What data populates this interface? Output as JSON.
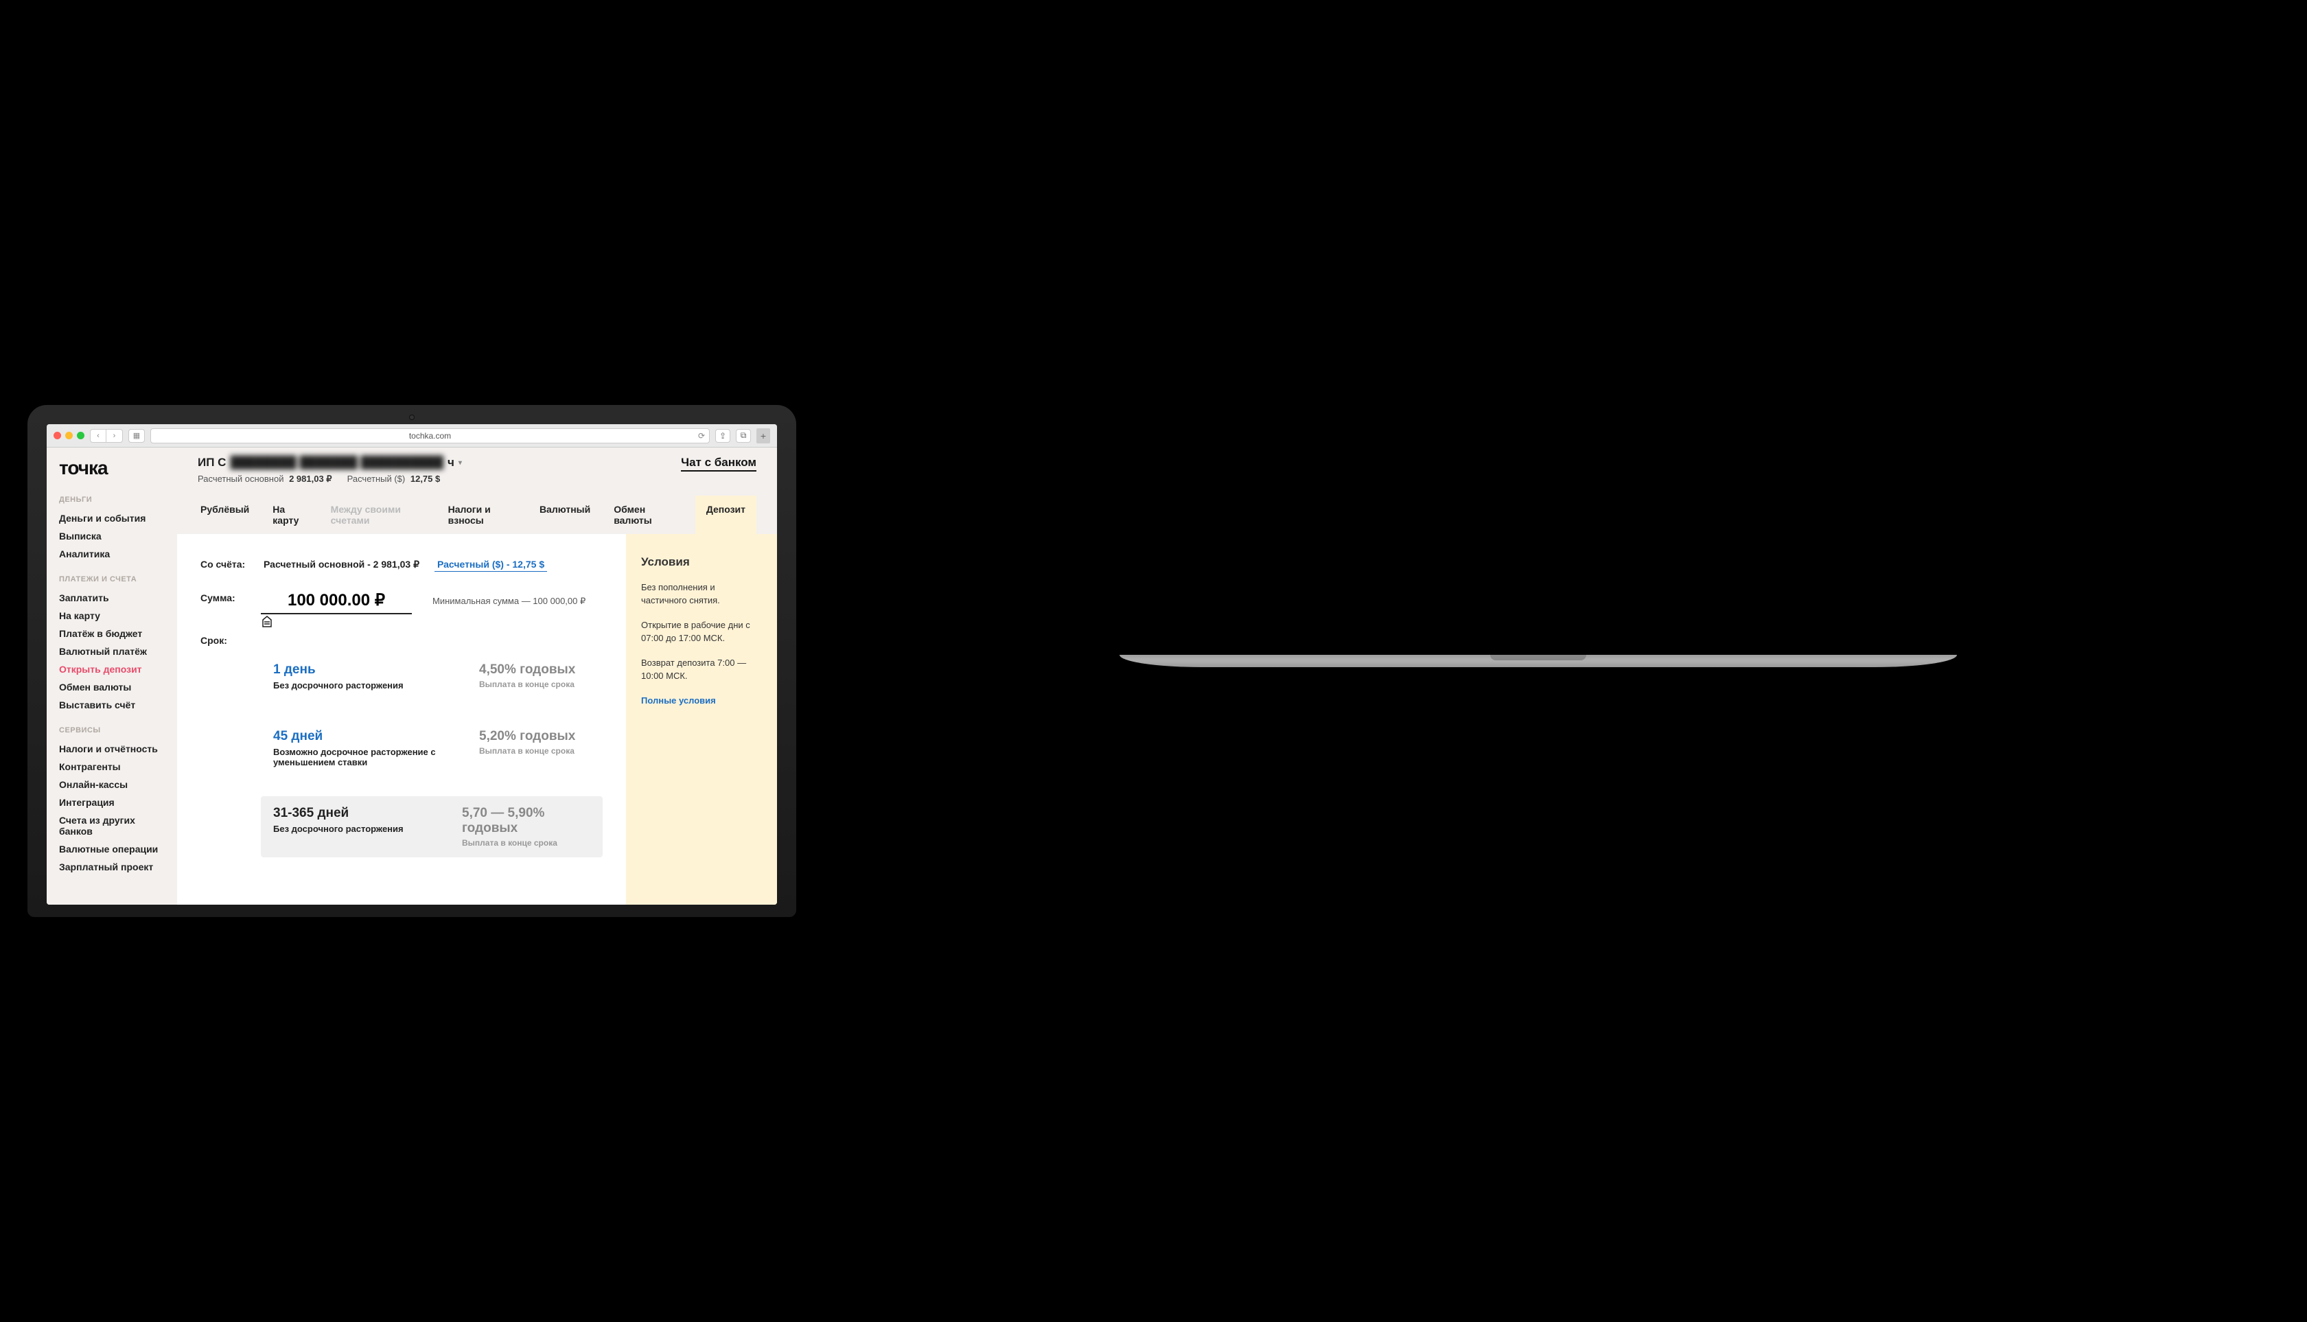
{
  "browser": {
    "url": "tochka.com"
  },
  "logo": "точка",
  "sidebar": {
    "sections": [
      {
        "head": "ДЕНЬГИ",
        "items": [
          "Деньги и события",
          "Выписка",
          "Аналитика"
        ]
      },
      {
        "head": "ПЛАТЕЖИ И СЧЕТА",
        "items": [
          "Заплатить",
          "На карту",
          "Платёж в бюджет",
          "Валютный платёж",
          "Открыть депозит",
          "Обмен валюты",
          "Выставить счёт"
        ],
        "active": 4
      },
      {
        "head": "СЕРВИСЫ",
        "items": [
          "Налоги и отчётность",
          "Контрагенты",
          "Онлайн-кассы",
          "Интеграция",
          "Счета из других банков",
          "Валютные операции",
          "Зарплатный проект"
        ]
      }
    ]
  },
  "header": {
    "user_prefix": "ИП С",
    "user_blur": "████████ ███████ ██████████",
    "user_suffix": "ч",
    "balances": [
      {
        "label": "Расчетный основной",
        "value": "2 981,03 ₽"
      },
      {
        "label": "Расчетный ($)",
        "value": "12,75 $"
      }
    ],
    "chat": "Чат с банком"
  },
  "tabs": [
    "Рублёвый",
    "На карту",
    "Между своими счетами",
    "Налоги и взносы",
    "Валютный",
    "Обмен валюты",
    "Депозит"
  ],
  "tabs_disabled_index": 2,
  "tabs_active_index": 6,
  "form": {
    "from_label": "Со счёта:",
    "accounts": [
      {
        "text": "Расчетный основной - 2 981,03 ₽",
        "link": false
      },
      {
        "text": "Расчетный ($) - 12,75 $",
        "link": true
      }
    ],
    "amount_label": "Сумма:",
    "amount_value": "100 000.00 ₽",
    "min_note": "Минимальная сумма — 100 000,00 ₽",
    "term_label": "Срок:",
    "terms": [
      {
        "title": "1 день",
        "desc": "Без досрочного расторжения",
        "rate": "4,50% годовых",
        "note": "Выплата в конце срока",
        "selected": false
      },
      {
        "title": "45 дней",
        "desc": "Возможно досрочное расторжение с уменьшением ставки",
        "rate": "5,20% годовых",
        "note": "Выплата в конце срока",
        "selected": false
      },
      {
        "title": "31-365 дней",
        "desc": "Без досрочного расторжения",
        "rate": "5,70 — 5,90% годовых",
        "note": "Выплата в конце срока",
        "selected": true
      }
    ]
  },
  "conditions": {
    "title": "Условия",
    "p1": "Без пополнения и частичного снятия.",
    "p2": "Открытие в рабочие дни с 07:00 до 17:00 МСК.",
    "p3": "Возврат депозита 7:00 — 10:00 МСК.",
    "link": "Полные условия"
  }
}
